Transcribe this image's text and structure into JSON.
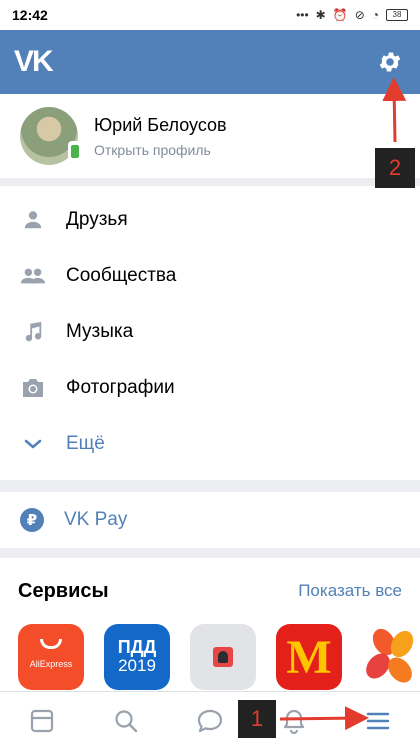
{
  "status_bar": {
    "time": "12:42",
    "battery": "38"
  },
  "header": {
    "logo": "VK"
  },
  "profile": {
    "name": "Юрий Белоусов",
    "subtitle": "Открыть профиль"
  },
  "menu": [
    {
      "label": "Друзья",
      "icon": "person-icon"
    },
    {
      "label": "Сообщества",
      "icon": "people-icon"
    },
    {
      "label": "Музыка",
      "icon": "music-note-icon"
    },
    {
      "label": "Фотографии",
      "icon": "camera-icon"
    },
    {
      "label": "Ещё",
      "icon": "chevron-down-icon"
    }
  ],
  "vkpay": {
    "label": "VK Pay",
    "symbol": "₽"
  },
  "services": {
    "title": "Сервисы",
    "show_all": "Показать все",
    "apps": [
      {
        "name": "AliExpress",
        "label": "AliExpress"
      },
      {
        "name": "ПДД 2019",
        "line1": "ПДД",
        "line2": "2019"
      },
      {
        "name": "game"
      },
      {
        "name": "McDonald's",
        "letter": "M"
      },
      {
        "name": "petals"
      }
    ]
  },
  "tabs": [
    "news-icon",
    "search-icon",
    "messages-icon",
    "notifications-icon",
    "menu-icon"
  ],
  "annotations": {
    "badge1": "1",
    "badge2": "2",
    "color": "#e23c2f"
  },
  "colors": {
    "brand": "#5181b8",
    "online": "#4bb34b"
  }
}
